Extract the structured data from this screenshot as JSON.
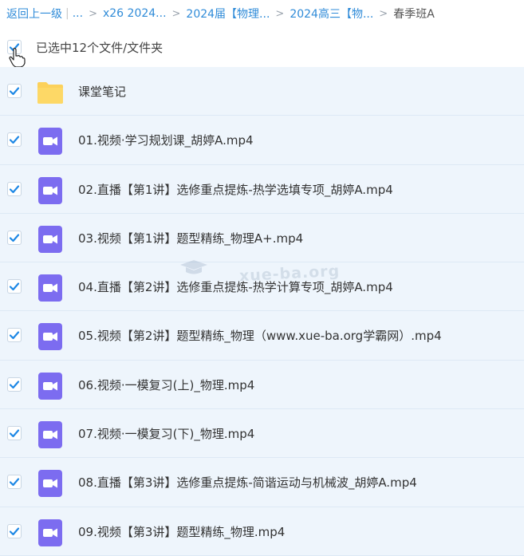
{
  "breadcrumb": {
    "back_label": "返回上一级",
    "separator": "|",
    "ellipsis": "...",
    "items": [
      "x26 2024...",
      "2024届【物理...",
      "2024高三【物..."
    ],
    "current": "春季班A"
  },
  "selection": {
    "label": "已选中12个文件/文件夹",
    "checked": true
  },
  "files": [
    {
      "name": "课堂笔记",
      "type": "folder-icon",
      "checked": true
    },
    {
      "name": "01.视频·学习规划课_胡婷A.mp4",
      "type": "video-icon",
      "checked": true
    },
    {
      "name": "02.直播【第1讲】选修重点提炼-热学选填专项_胡婷A.mp4",
      "type": "video-icon",
      "checked": true
    },
    {
      "name": "03.视频【第1讲】题型精练_物理A+.mp4",
      "type": "video-icon",
      "checked": true
    },
    {
      "name": "04.直播【第2讲】选修重点提炼-热学计算专项_胡婷A.mp4",
      "type": "video-icon",
      "checked": true
    },
    {
      "name": "05.视频【第2讲】题型精练_物理（www.xue-ba.org学霸网）.mp4",
      "type": "video-icon",
      "checked": true
    },
    {
      "name": "06.视频·一模复习(上)_物理.mp4",
      "type": "video-icon",
      "checked": true
    },
    {
      "name": "07.视频·一模复习(下)_物理.mp4",
      "type": "video-icon",
      "checked": true
    },
    {
      "name": "08.直播【第3讲】选修重点提炼-简谐运动与机械波_胡婷A.mp4",
      "type": "video-icon",
      "checked": true
    },
    {
      "name": "09.视频【第3讲】题型精练_物理.mp4",
      "type": "video-icon",
      "checked": true
    }
  ],
  "watermark": "xue-ba.org",
  "colors": {
    "link": "#2f8bd8",
    "row_bg": "#eef5fc",
    "check": "#1e88e5",
    "folder": "#fcd15b",
    "video": "#7c6cf0"
  }
}
